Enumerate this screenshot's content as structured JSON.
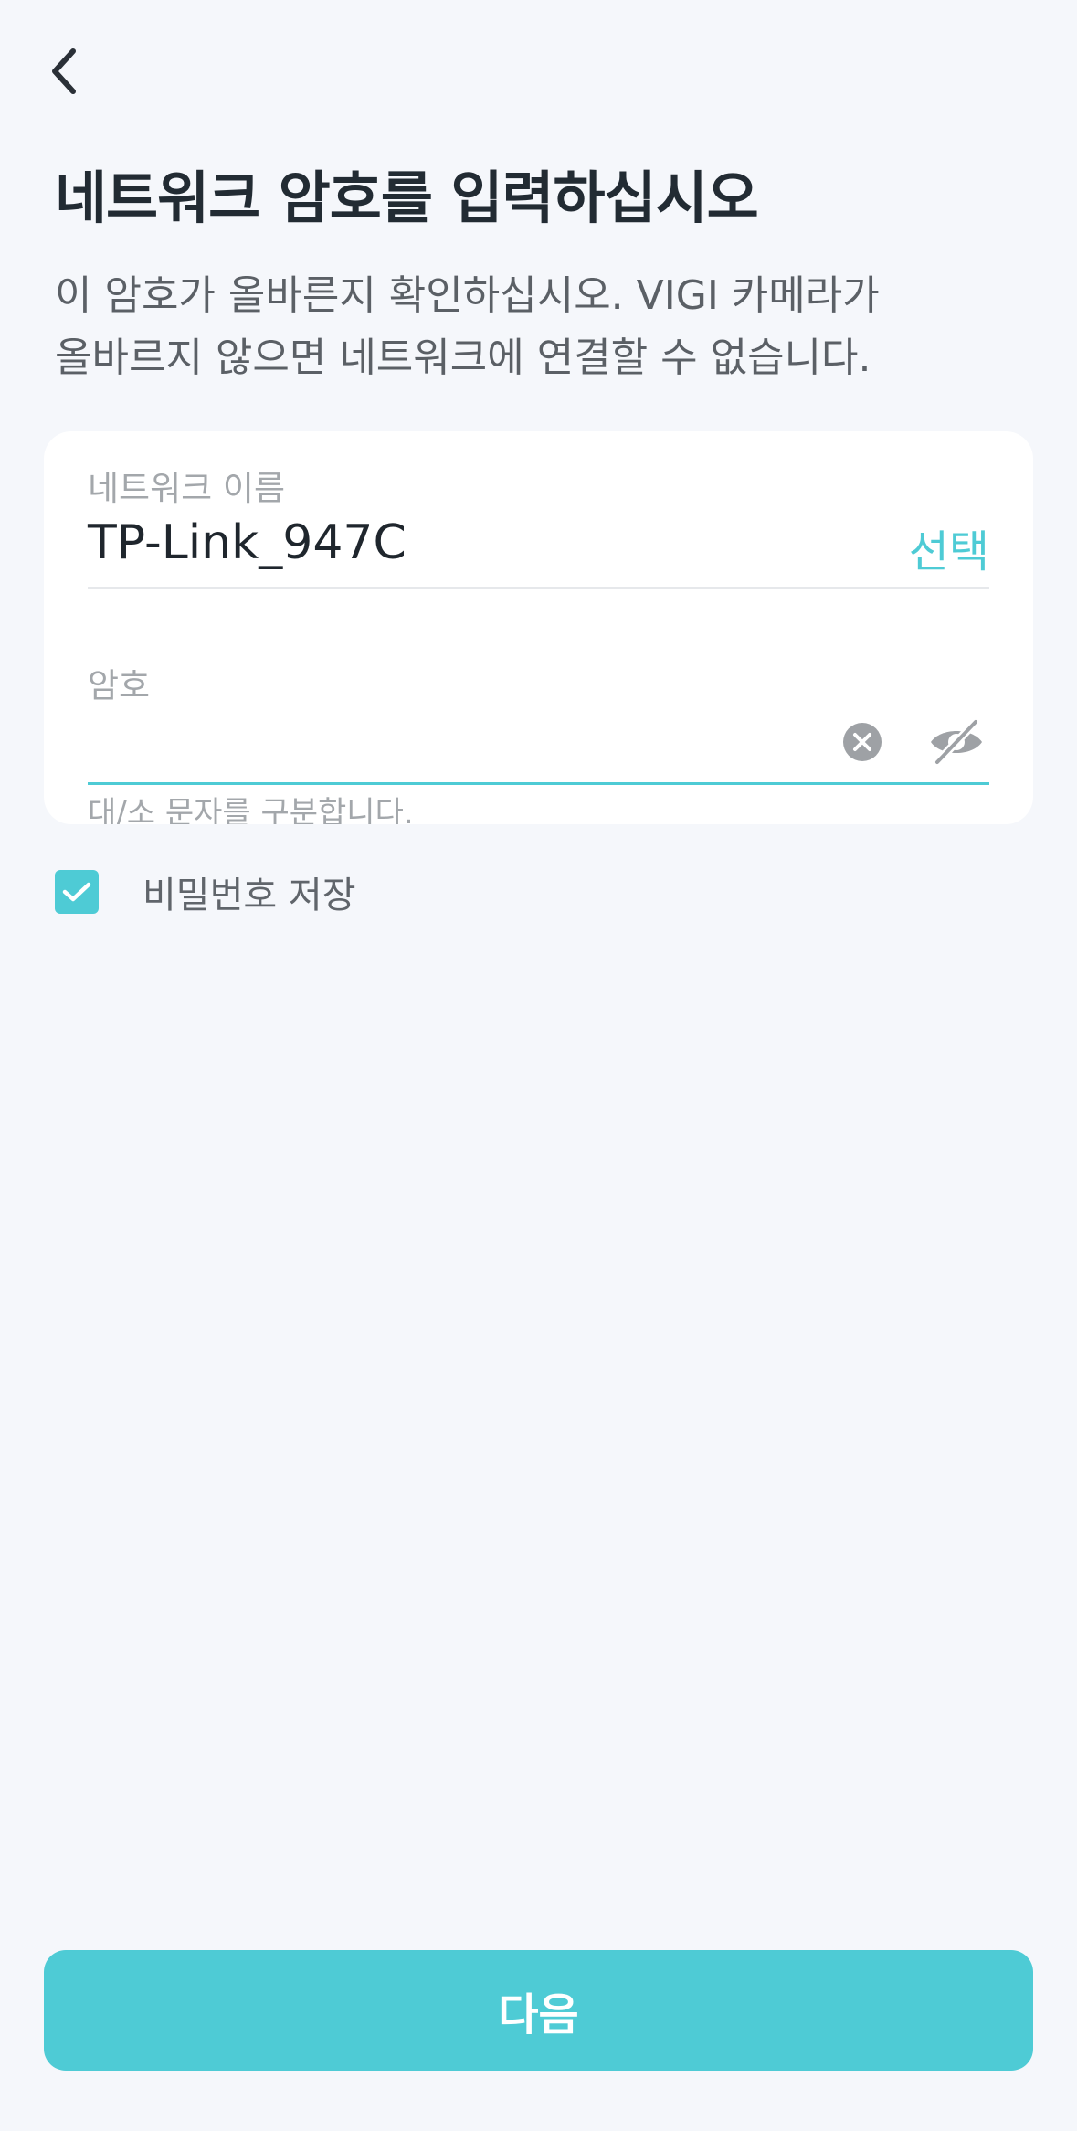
{
  "header": {
    "back_icon": "chevron-left-icon",
    "title": "네트워크 암호를 입력하십시오",
    "description_line1": "이 암호가 올바른지 확인하십시오. VIGI 카메라가",
    "description_line2": "올바르지 않으면 네트워크에 연결할 수 없습니다."
  },
  "form": {
    "ssid_label": "네트워크 이름",
    "ssid_value": "TP-Link_947C",
    "select_label": "선택",
    "password_label": "암호",
    "password_value": "",
    "clear_icon": "clear-circle-icon",
    "visibility_icon": "eye-off-icon",
    "hint": "대/소 문자를 구분합니다."
  },
  "save_password": {
    "checked": true,
    "label": "비밀번호 저장",
    "icon": "checkmark-icon"
  },
  "footer": {
    "next_label": "다음"
  },
  "colors": {
    "accent": "#4ecbd5",
    "background": "#f5f7fb",
    "title": "#222b33",
    "muted": "#a3a7ab"
  }
}
